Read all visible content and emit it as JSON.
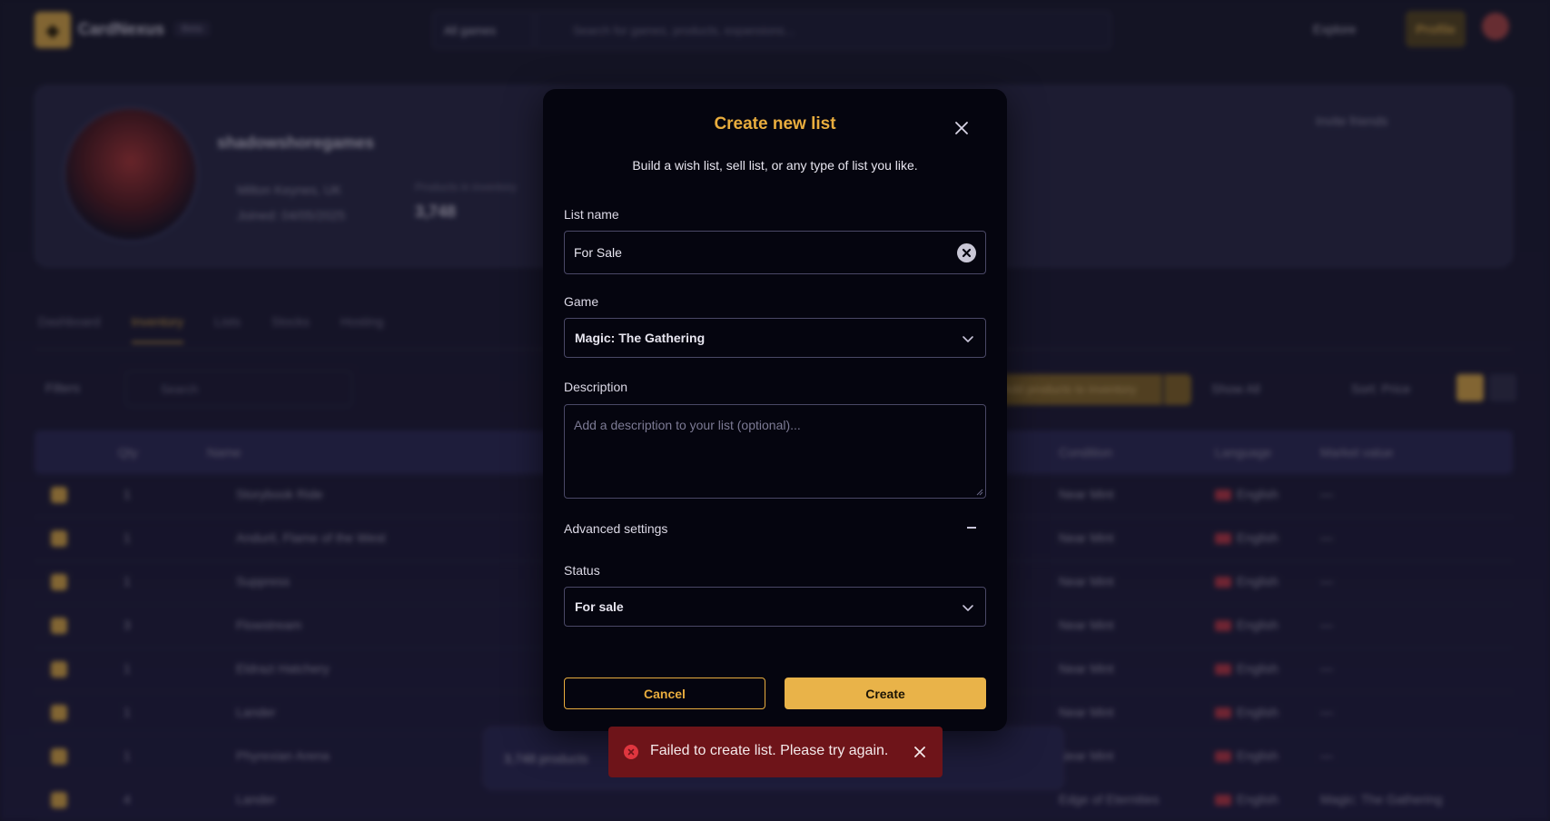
{
  "background": {
    "brand": "CardNexus",
    "badge": "Beta",
    "game_select": "All games",
    "search_placeholder": "Search for games, products, expansions...",
    "explore": "Explore",
    "profile_btn": "Profile",
    "profile": {
      "name": "shadowshoregames",
      "location": "Milton Keynes, UK",
      "joined": "Joined: 04/05/2025",
      "stat_label": "Products in inventory",
      "stat_value": "3,748",
      "invite": "Invite friends"
    },
    "tabs": [
      "Dashboard",
      "Inventory",
      "Lists",
      "Stocks",
      "Hosting"
    ],
    "filters": "Filters",
    "search": "Search",
    "add_btn": "Add products to inventory",
    "show_all": "Show All",
    "sort": "Sort: Price",
    "table_headers": [
      "Qty",
      "Name",
      "Condition",
      "Language",
      "Market value"
    ],
    "rows": [
      {
        "qty": "1",
        "name": "Storybook Ride",
        "cond": "Near Mint",
        "lang": "English",
        "value": "—"
      },
      {
        "qty": "1",
        "name": "Anduril, Flame of the West",
        "cond": "Near Mint",
        "lang": "English",
        "value": "—"
      },
      {
        "qty": "1",
        "name": "Suppress",
        "cond": "Near Mint",
        "lang": "English",
        "value": "—"
      },
      {
        "qty": "3",
        "name": "Flowstream",
        "cond": "Near Mint",
        "lang": "English",
        "value": "—"
      },
      {
        "qty": "1",
        "name": "Eldrazi Hatchery",
        "cond": "Near Mint",
        "lang": "English",
        "value": "—"
      },
      {
        "qty": "1",
        "name": "Lander",
        "cond": "Near Mint",
        "lang": "English",
        "value": "—"
      },
      {
        "qty": "1",
        "name": "Phyrexian Arena",
        "cond": "Near Mint",
        "lang": "English",
        "value": "—"
      },
      {
        "qty": "4",
        "name": "Lander",
        "cond": "Edge of Eternities",
        "lang": "English",
        "value": "Magic: The Gathering"
      }
    ],
    "toolbar_text": "3,748 products"
  },
  "modal": {
    "title": "Create new list",
    "subtitle": "Build a wish list, sell list, or any type of list you like.",
    "list_name_label": "List name",
    "list_name_value": "For Sale",
    "game_label": "Game",
    "game_value": "Magic: The Gathering",
    "description_label": "Description",
    "description_placeholder": "Add a description to your list (optional)...",
    "advanced_label": "Advanced settings",
    "status_label": "Status",
    "status_value": "For sale",
    "cancel_label": "Cancel",
    "create_label": "Create"
  },
  "toast": {
    "message": "Failed to create list. Please try again.",
    "color": "#6e1419"
  },
  "colors": {
    "accent": "#e9ad3e",
    "modal_bg": "#05050f",
    "error": "#e0363f"
  }
}
